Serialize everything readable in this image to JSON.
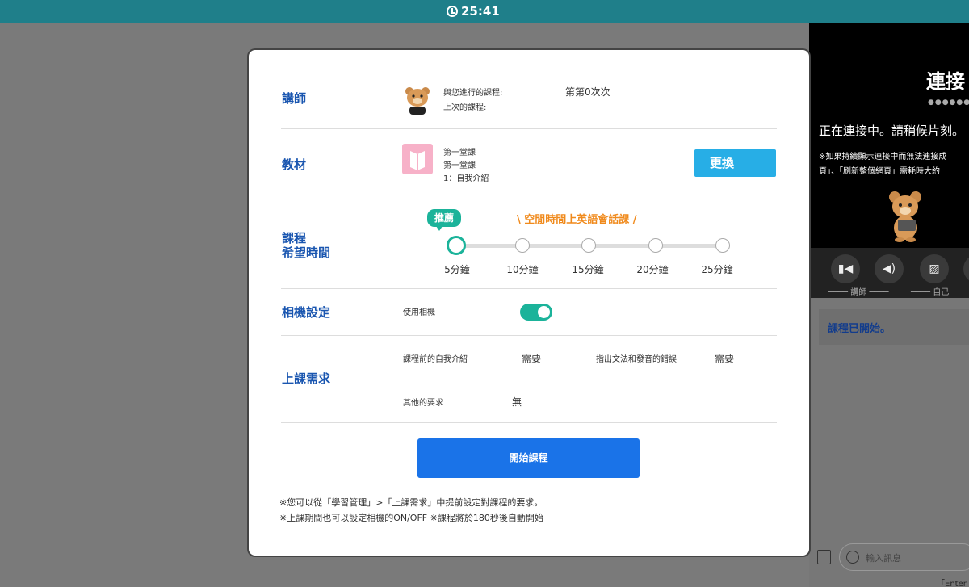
{
  "header": {
    "timer": "25:41"
  },
  "modal": {
    "teacher": {
      "label": "講師",
      "session_label": "與您進行的課程:",
      "session_value": "第第0次次",
      "last_label": "上次的課程:"
    },
    "material": {
      "label": "教材",
      "line1": "第一堂課",
      "line2": "第一堂課",
      "line3": "1：自我介紹",
      "change_label": "更換"
    },
    "duration": {
      "label_line1": "課程",
      "label_line2": "希望時間",
      "recommend_label": "推薦",
      "slogan": "\\ 空閒時間上英語會話課 /",
      "options": [
        "5分鐘",
        "10分鐘",
        "15分鐘",
        "20分鐘",
        "25分鐘"
      ],
      "selected_index": 0
    },
    "camera": {
      "label": "相機設定",
      "use_camera_label": "使用相機",
      "enabled": true
    },
    "requests": {
      "label": "上課需求",
      "self_intro_label": "課程前的自我介紹",
      "self_intro_value": "需要",
      "correction_label": "指出文法和發音的錯誤",
      "correction_value": "需要",
      "other_label": "其他的要求",
      "other_value": "無"
    },
    "start_label": "開始課程",
    "notes": [
      "※您可以從「學習管理」>「上課需求」中提前設定對課程的要求。",
      "※上課期間也可以設定相機的ON/OFF ※課程將於180秒後自動開始"
    ]
  },
  "side_panel": {
    "title": "連接",
    "dots": "●●●●●●●",
    "status": "正在連接中。請稍候片刻。",
    "note_line1": "※如果持續顯示連接中而無法連接成",
    "note_line2": "頁」、「刷新整個網頁」需耗時大約",
    "roles": [
      "講師",
      "自己"
    ],
    "chat_message": "課程已開始。",
    "input_placeholder": "輸入訊息",
    "enter_hint": "「Enter"
  },
  "colors": {
    "accent_teal": "#1bb39a",
    "label_blue": "#1a56b0",
    "button_blue": "#1a73e8",
    "change_blue": "#27aee6",
    "slogan_orange": "#f08a1c",
    "topbar": "#1f7f8a"
  }
}
